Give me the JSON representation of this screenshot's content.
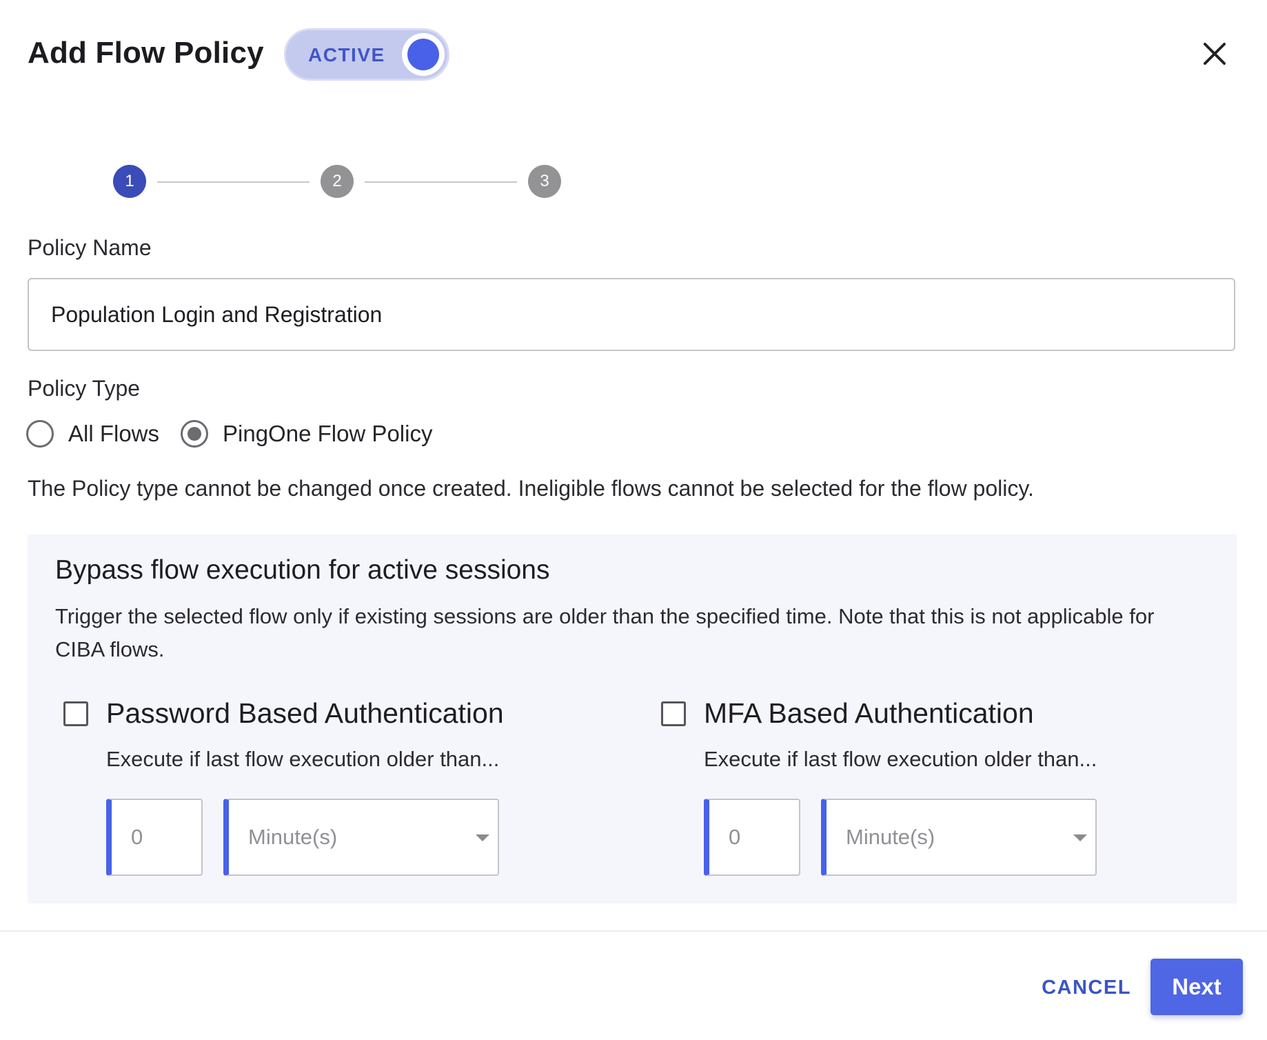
{
  "dialog": {
    "title": "Add Flow Policy",
    "status_toggle": {
      "label": "ACTIVE",
      "on": true,
      "accent_color": "#4861e8"
    },
    "close_icon": "close-icon"
  },
  "stepper": {
    "steps": [
      "1",
      "2",
      "3"
    ],
    "current_step": 1,
    "active_color": "#3b4cb8",
    "inactive_color": "#939395"
  },
  "form": {
    "policy_name_label": "Policy Name",
    "policy_name_value": "Population Login and Registration",
    "policy_type_label": "Policy Type",
    "policy_type_options": [
      {
        "label": "All Flows",
        "selected": false
      },
      {
        "label": "PingOne Flow Policy",
        "selected": true
      }
    ],
    "policy_type_help": "The Policy type cannot be changed once created. Ineligible flows cannot be selected for the flow policy."
  },
  "bypass": {
    "title": "Bypass flow execution for active sessions",
    "description": "Trigger the selected flow only if existing sessions are older than the specified time. Note that this is not applicable for CIBA flows.",
    "password_auth": {
      "label": "Password Based Authentication",
      "checked": false,
      "sub_label": "Execute if last flow execution older than...",
      "value": "0",
      "unit": "Minute(s)"
    },
    "mfa_auth": {
      "label": "MFA Based Authentication",
      "checked": false,
      "sub_label": "Execute if last flow execution older than...",
      "value": "0",
      "unit": "Minute(s)"
    }
  },
  "footer": {
    "cancel_label": "CANCEL",
    "next_label": "Next",
    "primary_color": "#4f66e5"
  }
}
